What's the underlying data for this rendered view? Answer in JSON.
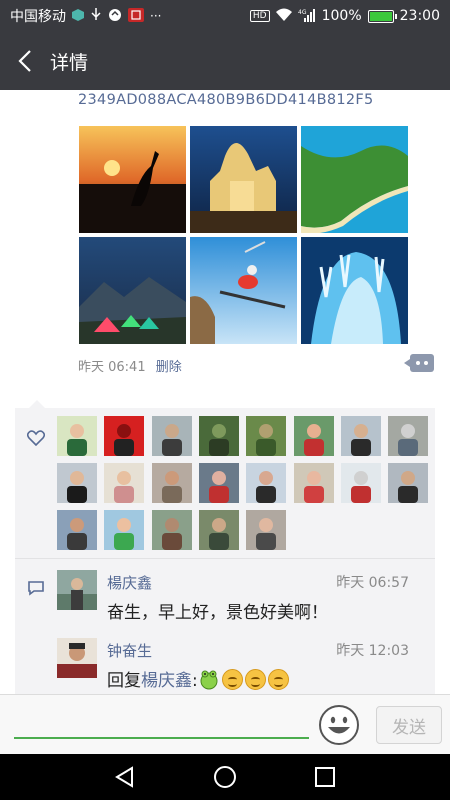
{
  "status_bar": {
    "carrier": "中国移动",
    "network": "4G",
    "hd": "HD",
    "battery": "100%",
    "battery_level": 1.0,
    "time": "23:00"
  },
  "titlebar": {
    "title": "详情"
  },
  "post": {
    "hash_text": "2349AD088ACA480B9B6DD414B812F5",
    "photos": [
      {
        "icon": "sunset-crane-photo"
      },
      {
        "icon": "cathedral-night-photo"
      },
      {
        "icon": "coastline-aerial-photo"
      },
      {
        "icon": "tents-starry-night-photo"
      },
      {
        "icon": "skier-jump-photo"
      },
      {
        "icon": "ice-cave-photo"
      }
    ],
    "time": "昨天 06:41",
    "delete_label": "删除"
  },
  "likes": {
    "count": 23
  },
  "comments": [
    {
      "name": "楊庆鑫",
      "time": "昨天 06:57",
      "text": "奋生，早上好，景色好美啊！"
    },
    {
      "name": "钟奋生",
      "time": "昨天 12:03",
      "reply_prefix": "回复",
      "reply_to": "楊庆鑫",
      "reply_colon": ":"
    }
  ],
  "input": {
    "placeholder": "",
    "send_label": "发送"
  },
  "colors": {
    "bar": "#393a3f",
    "link": "#576b95",
    "accent_green": "#4cad4f"
  }
}
